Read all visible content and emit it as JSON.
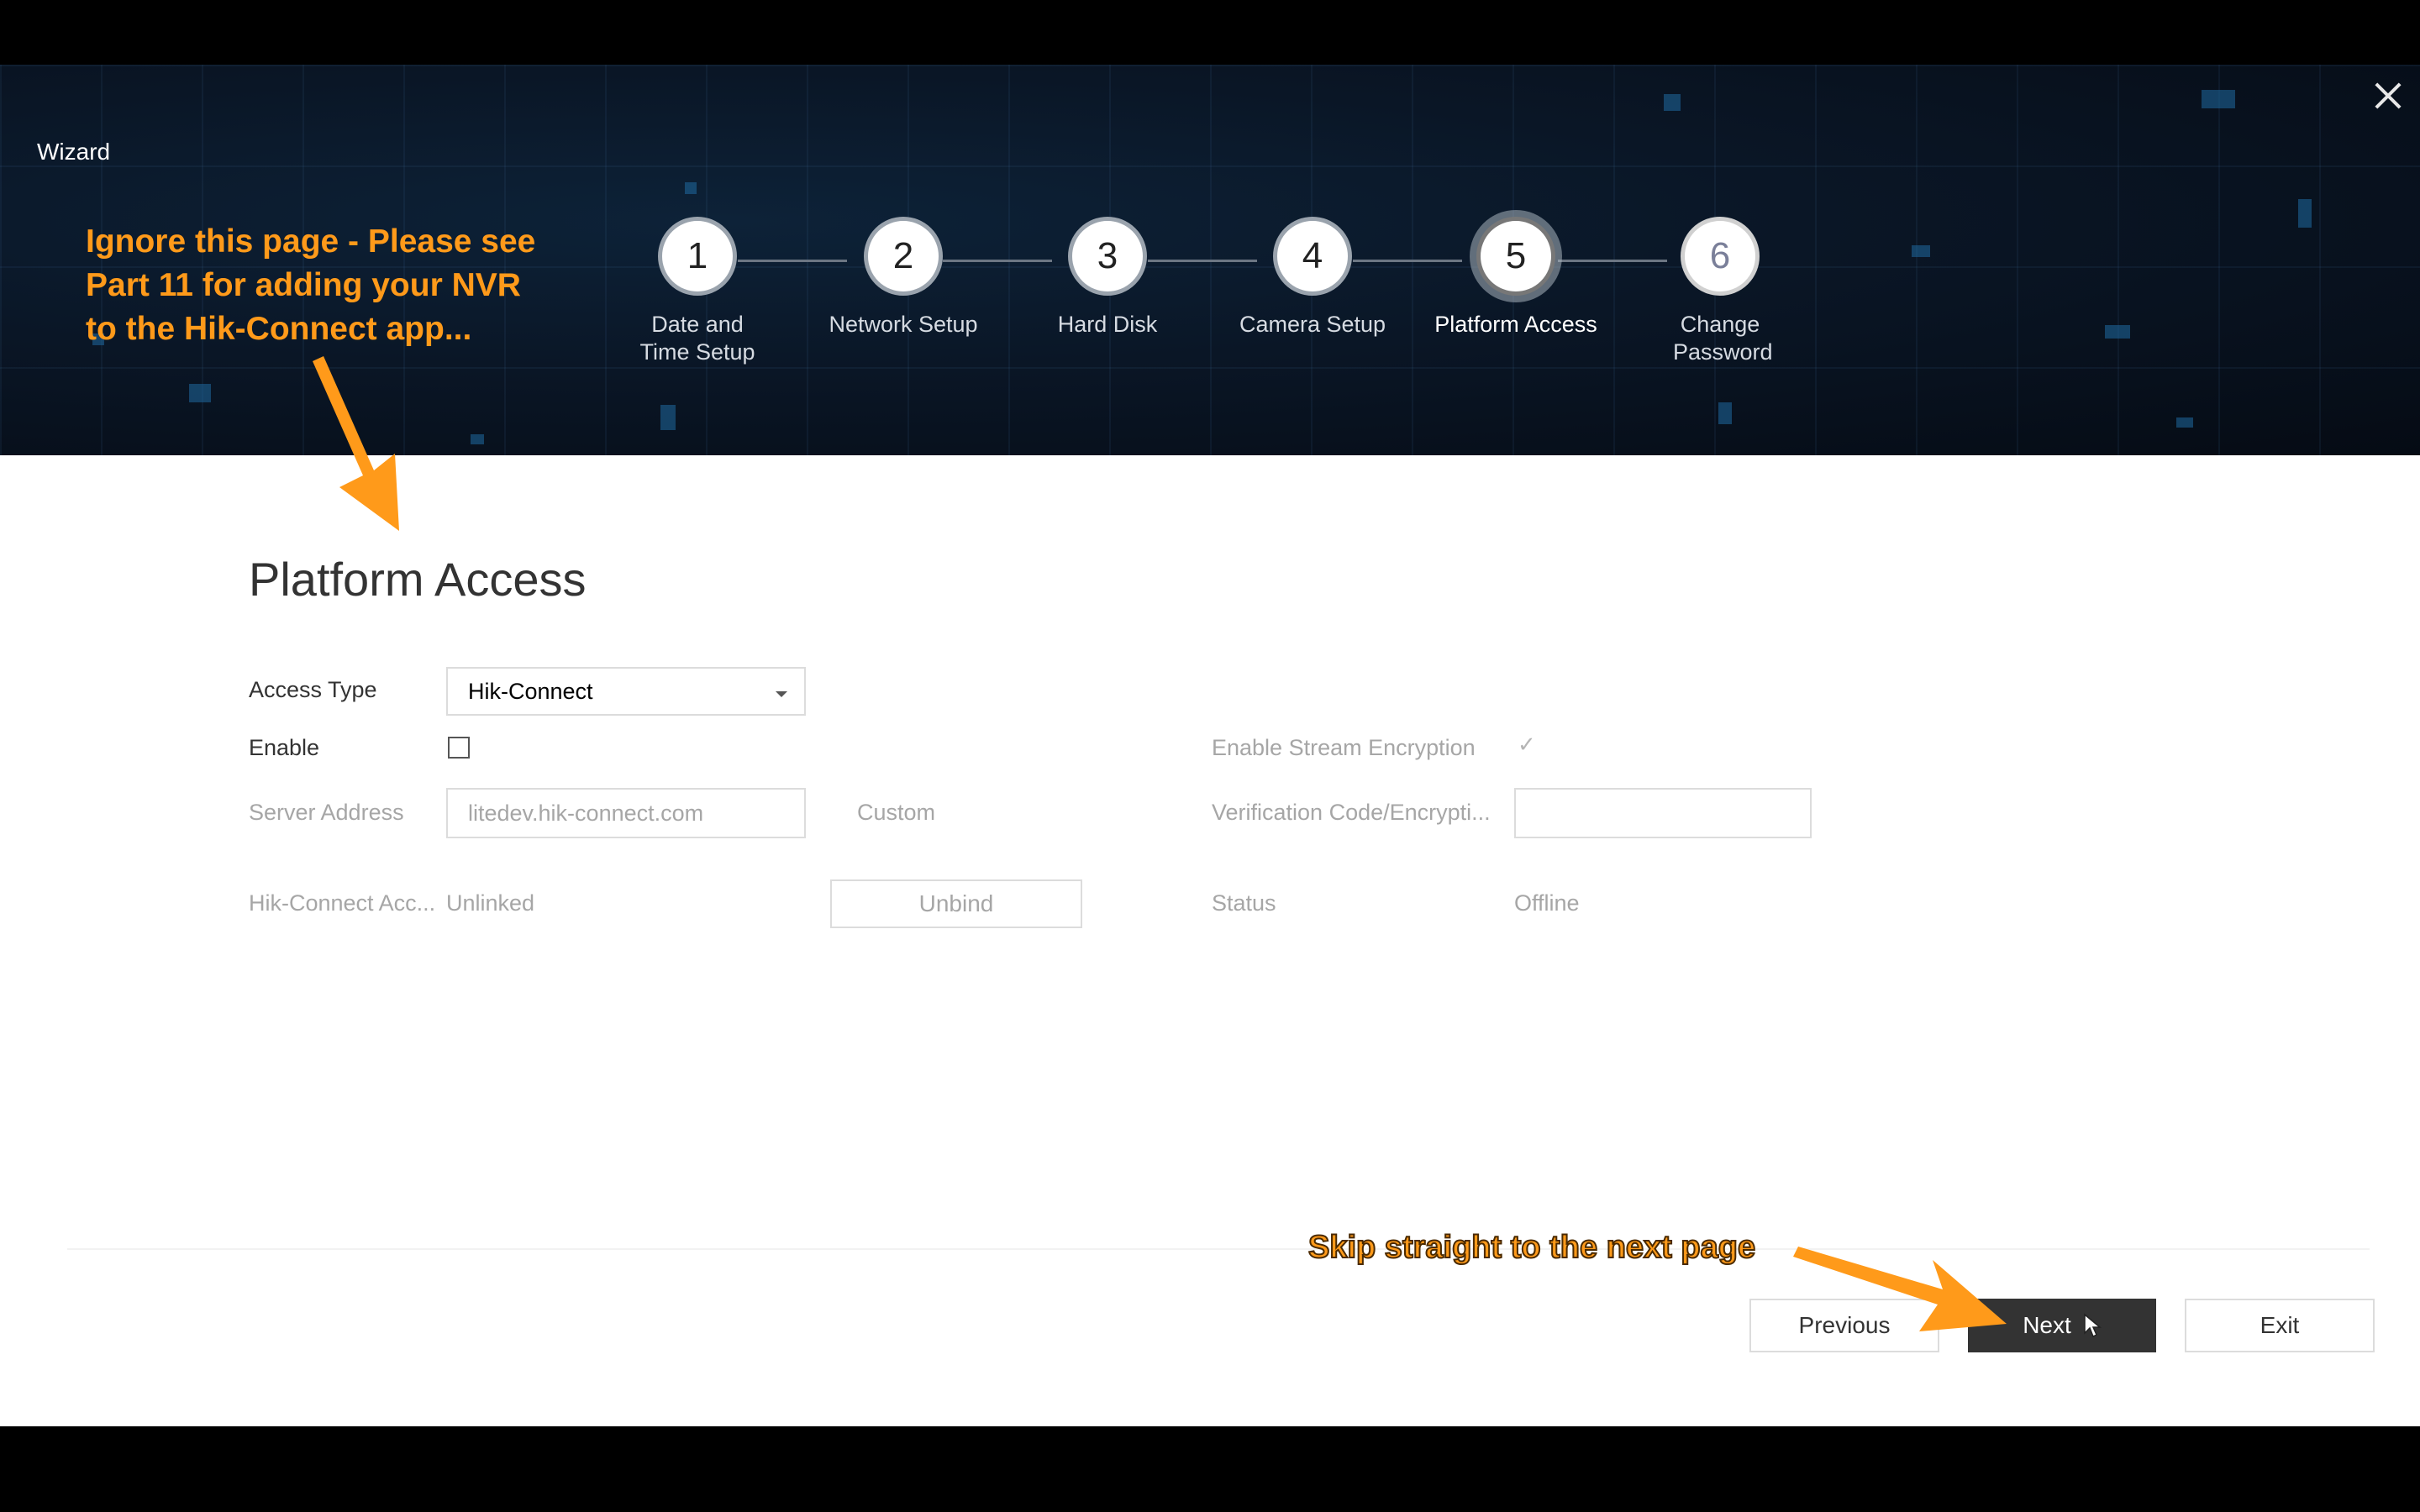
{
  "window": {
    "title": "Wizard"
  },
  "steps": [
    {
      "number": "1",
      "label": "Date and Time Setup",
      "state": "done"
    },
    {
      "number": "2",
      "label": "Network Setup",
      "state": "done"
    },
    {
      "number": "3",
      "label": "Hard Disk",
      "state": "done"
    },
    {
      "number": "4",
      "label": "Camera Setup",
      "state": "done"
    },
    {
      "number": "5",
      "label": "Platform Access",
      "state": "active"
    },
    {
      "number": "6",
      "label": "Change Password",
      "state": "pending"
    }
  ],
  "page": {
    "title": "Platform Access"
  },
  "form": {
    "access_type_label": "Access Type",
    "access_type_value": "Hik-Connect",
    "enable_label": "Enable",
    "enable_checked": false,
    "enable_stream_encryption_label": "Enable Stream Encryption",
    "enable_stream_encryption_checked": true,
    "server_address_label": "Server Address",
    "server_address_value": "litedev.hik-connect.com",
    "custom_label": "Custom",
    "verification_code_label": "Verification Code/Encrypti...",
    "verification_code_value": "",
    "account_label": "Hik-Connect Acc...",
    "account_value": "Unlinked",
    "unbind_label": "Unbind",
    "status_label": "Status",
    "status_value": "Offline"
  },
  "footer": {
    "previous_label": "Previous",
    "next_label": "Next",
    "exit_label": "Exit"
  },
  "annotations": {
    "top_note": [
      "Ignore this page - Please see",
      "Part 11 for adding your NVR",
      "to the Hik-Connect app..."
    ],
    "bottom_note": "Skip straight to the next page",
    "color": "#ff9a1a"
  },
  "icons": {
    "close": "close-icon",
    "dropdown": "chevron-down-icon",
    "cursor": "mouse-pointer-icon",
    "check": "check-icon"
  }
}
